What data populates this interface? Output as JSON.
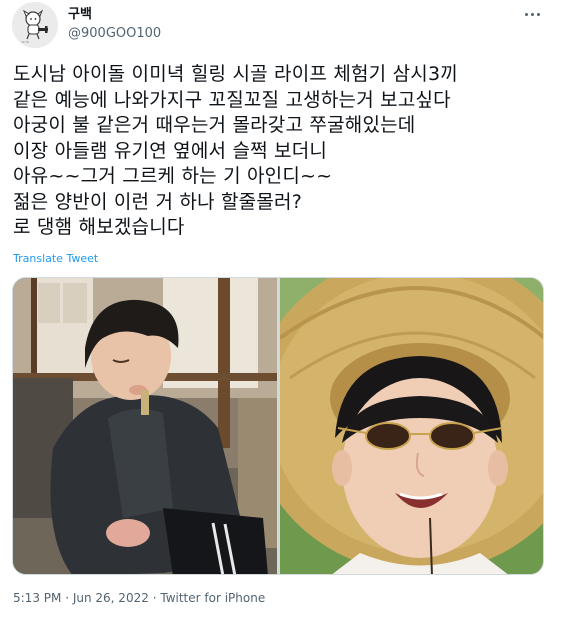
{
  "author": {
    "display_name": "구백",
    "handle": "@900GOO100"
  },
  "tweet": {
    "lines": [
      "도시남 아이돌 이미녁 힐링 시골 라이프 체험기 삼시3끼",
      "같은 예능에 나와가지구 꼬질꼬질 고생하는거 보고싶다",
      "아궁이 불 같은거 때우는거 몰라갖고 쭈굴해있는데",
      "이장 아들램 유기연 옆에서 슬쩍 보더니",
      "아유~~그거 그르케 하는 기 아인디~~",
      "젊은 양반이 이런 거 하나 할줄몰러?",
      "로 댕햄 해보겠습니다"
    ],
    "translate_label": "Translate Tweet",
    "time": "5:13 PM",
    "separator": "·",
    "date": "Jun 26, 2022",
    "source": "Twitter for iPhone"
  },
  "icons": {
    "avatar": "avatar-icon",
    "more": "more-horizontal-icon"
  },
  "colors": {
    "link": "#1d9bf0",
    "secondary_text": "#536471",
    "primary_text": "#0f1419",
    "border": "#cfd9de"
  }
}
